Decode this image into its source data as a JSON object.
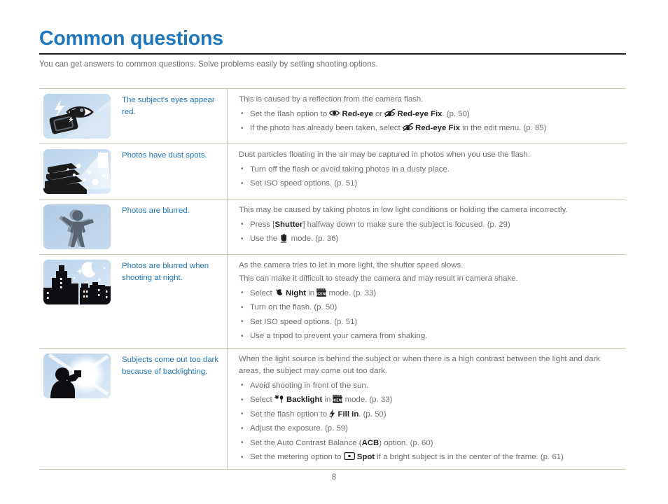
{
  "header": {
    "title": "Common questions",
    "subtitle": "You can get answers to common questions. Solve problems easily by setting shooting options.",
    "title_color": "#1e76bd"
  },
  "footer": {
    "page_number": "8"
  },
  "table": {
    "rows": [
      {
        "thumb_name": "red-eye-flash-photo",
        "question": "The subject's eyes appear red.",
        "intro": "This is caused by a reflection from the camera flash.",
        "bullets": [
          {
            "segments": [
              {
                "t": "text",
                "v": "Set the flash option to "
              },
              {
                "t": "icon",
                "v": "red-eye-icon"
              },
              {
                "t": "bold",
                "v": "Red-eye"
              },
              {
                "t": "text",
                "v": " or "
              },
              {
                "t": "icon",
                "v": "red-eye-fix-icon"
              },
              {
                "t": "bold",
                "v": "Red-eye Fix"
              },
              {
                "t": "text",
                "v": ". (p. 50)"
              }
            ]
          },
          {
            "segments": [
              {
                "t": "text",
                "v": "If the photo has already been taken, select "
              },
              {
                "t": "icon",
                "v": "red-eye-fix-icon"
              },
              {
                "t": "bold",
                "v": "Red-eye Fix"
              },
              {
                "t": "text",
                "v": " in the edit menu. (p. 85)"
              }
            ]
          }
        ]
      },
      {
        "thumb_name": "dust-spots-photo",
        "question": "Photos have dust spots.",
        "intro": "Dust particles floating in the air may be captured in photos when you use the flash.",
        "bullets": [
          {
            "segments": [
              {
                "t": "text",
                "v": "Turn off the flash or avoid taking photos in a dusty place."
              }
            ]
          },
          {
            "segments": [
              {
                "t": "text",
                "v": "Set ISO speed options. (p. 51)"
              }
            ]
          }
        ]
      },
      {
        "thumb_name": "blurred-person-photo",
        "question": "Photos are blurred.",
        "intro": "This may be caused by taking photos in low light conditions or holding the camera incorrectly.",
        "bullets": [
          {
            "segments": [
              {
                "t": "text",
                "v": "Press ["
              },
              {
                "t": "bold",
                "v": "Shutter"
              },
              {
                "t": "text",
                "v": "] halfway down to make sure the subject is focused. (p. 29)"
              }
            ]
          },
          {
            "segments": [
              {
                "t": "text",
                "v": "Use the "
              },
              {
                "t": "icon",
                "v": "anti-shake-hand-icon"
              },
              {
                "t": "text",
                "v": " mode. (p. 36)"
              }
            ]
          }
        ]
      },
      {
        "thumb_name": "night-city-photo",
        "question": "Photos are blurred when shooting at night.",
        "intro": "As the camera tries to let in more light, the shutter speed slows.",
        "intro2": "This can make it difficult to steady the camera and may result in camera shake.",
        "bullets": [
          {
            "segments": [
              {
                "t": "text",
                "v": "Select "
              },
              {
                "t": "icon",
                "v": "night-mode-icon"
              },
              {
                "t": "bold",
                "v": "Night"
              },
              {
                "t": "text",
                "v": " in "
              },
              {
                "t": "icon",
                "v": "scene-mode-icon"
              },
              {
                "t": "text",
                "v": " mode. (p. 33)"
              }
            ]
          },
          {
            "segments": [
              {
                "t": "text",
                "v": "Turn on the flash. (p. 50)"
              }
            ]
          },
          {
            "segments": [
              {
                "t": "text",
                "v": "Set ISO speed options. (p. 51)"
              }
            ]
          },
          {
            "segments": [
              {
                "t": "text",
                "v": "Use a tripod to prevent your camera from shaking."
              }
            ]
          }
        ]
      },
      {
        "thumb_name": "backlighting-photo",
        "question": "Subjects come out too dark because of backlighting.",
        "intro": "When the light source is behind the subject or when there is a high contrast between the light and dark areas, the subject may come out too dark.",
        "bullets": [
          {
            "segments": [
              {
                "t": "text",
                "v": "Avoid shooting in front of the sun."
              }
            ]
          },
          {
            "segments": [
              {
                "t": "text",
                "v": "Select "
              },
              {
                "t": "icon",
                "v": "backlight-mode-icon"
              },
              {
                "t": "bold",
                "v": "Backlight"
              },
              {
                "t": "text",
                "v": " in "
              },
              {
                "t": "icon",
                "v": "scene-mode-icon"
              },
              {
                "t": "text",
                "v": " mode. (p. 33)"
              }
            ]
          },
          {
            "segments": [
              {
                "t": "text",
                "v": "Set the flash option to "
              },
              {
                "t": "icon",
                "v": "fill-in-flash-icon"
              },
              {
                "t": "bold",
                "v": "Fill in"
              },
              {
                "t": "text",
                "v": ". (p. 50)"
              }
            ]
          },
          {
            "segments": [
              {
                "t": "text",
                "v": "Adjust the exposure. (p. 59)"
              }
            ]
          },
          {
            "segments": [
              {
                "t": "text",
                "v": "Set the Auto Contrast Balance ("
              },
              {
                "t": "bold",
                "v": "ACB"
              },
              {
                "t": "text",
                "v": ") option. (p. 60)"
              }
            ]
          },
          {
            "segments": [
              {
                "t": "text",
                "v": "Set the metering option to "
              },
              {
                "t": "icon",
                "v": "spot-metering-icon"
              },
              {
                "t": "bold",
                "v": "Spot"
              },
              {
                "t": "text",
                "v": " if a bright subject is in the center of the frame. (p. 61)"
              }
            ]
          }
        ]
      }
    ]
  }
}
